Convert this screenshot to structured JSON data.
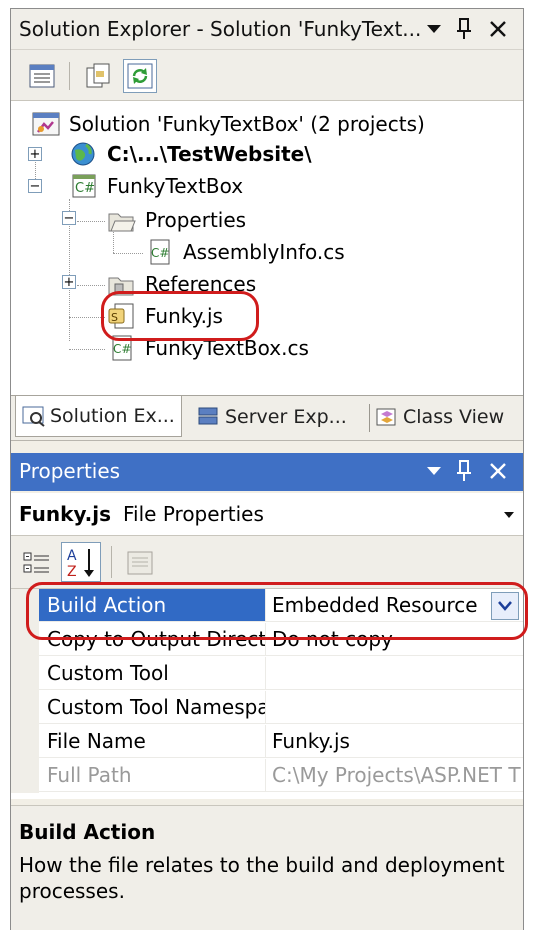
{
  "solution_explorer": {
    "title": "Solution Explorer - Solution 'FunkyText...",
    "tree": {
      "solution": "Solution 'FunkyTextBox' (2 projects)",
      "website": "C:\\...\\TestWebsite\\",
      "project": "FunkyTextBox",
      "properties_folder": "Properties",
      "assembly_info": "AssemblyInfo.cs",
      "references": "References",
      "funky_js": "Funky.js",
      "funky_textbox_cs": "FunkyTextBox.cs"
    },
    "tabs": [
      "Solution Ex...",
      "Server Exp...",
      "Class View"
    ]
  },
  "properties": {
    "title": "Properties",
    "object_name": "Funky.js",
    "object_type": "File Properties",
    "rows": [
      {
        "name": "Build Action",
        "value": "Embedded Resource"
      },
      {
        "name": "Copy to Output Directory",
        "value": "Do not copy"
      },
      {
        "name": "Custom Tool",
        "value": ""
      },
      {
        "name": "Custom Tool Namespace",
        "value": ""
      },
      {
        "name": "File Name",
        "value": "Funky.js"
      },
      {
        "name": "Full Path",
        "value": "C:\\My Projects\\ASP.NET T"
      }
    ],
    "description": {
      "title": "Build Action",
      "text": "How the file relates to the build and deployment processes."
    }
  },
  "colors": {
    "highlight_ring": "#d01c1c",
    "properties_title_bg": "#3f70c5",
    "selection": "#316ac5"
  }
}
